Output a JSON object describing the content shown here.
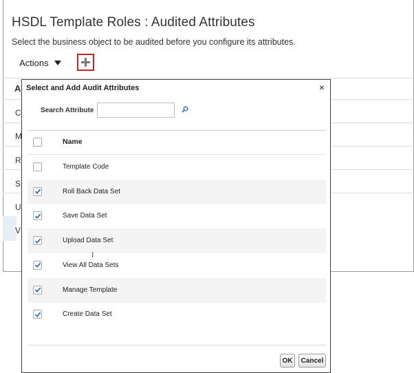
{
  "page": {
    "title": "HSDL Template Roles : Audited Attributes",
    "subtitle": "Select the business object to be audited before you configure its attributes.",
    "actions_label": "Actions",
    "add_icon": "plus-icon"
  },
  "background_table": {
    "header_first_letter": "A",
    "row_first_letters": [
      "C",
      "M",
      "R",
      "S",
      "U",
      "V"
    ]
  },
  "dialog": {
    "title": "Select and Add Audit Attributes",
    "close_glyph": "×",
    "search": {
      "label": "Search Attribute",
      "value": "",
      "placeholder": ""
    },
    "column_header": "Name",
    "rows": [
      {
        "name": "Template Code",
        "checked": false
      },
      {
        "name": "Roll Back Data Set",
        "checked": true
      },
      {
        "name": "Save Data Set",
        "checked": true
      },
      {
        "name": "Upload Data Set",
        "checked": true
      },
      {
        "name": "View All Data Sets",
        "checked": true
      },
      {
        "name": "Manage Template",
        "checked": true
      },
      {
        "name": "Create Data Set",
        "checked": true
      }
    ],
    "ok_label": "OK",
    "cancel_label": "Cancel"
  },
  "colors": {
    "accent_highlight": "#d81e1e",
    "checkmark": "#2f6fb5"
  }
}
